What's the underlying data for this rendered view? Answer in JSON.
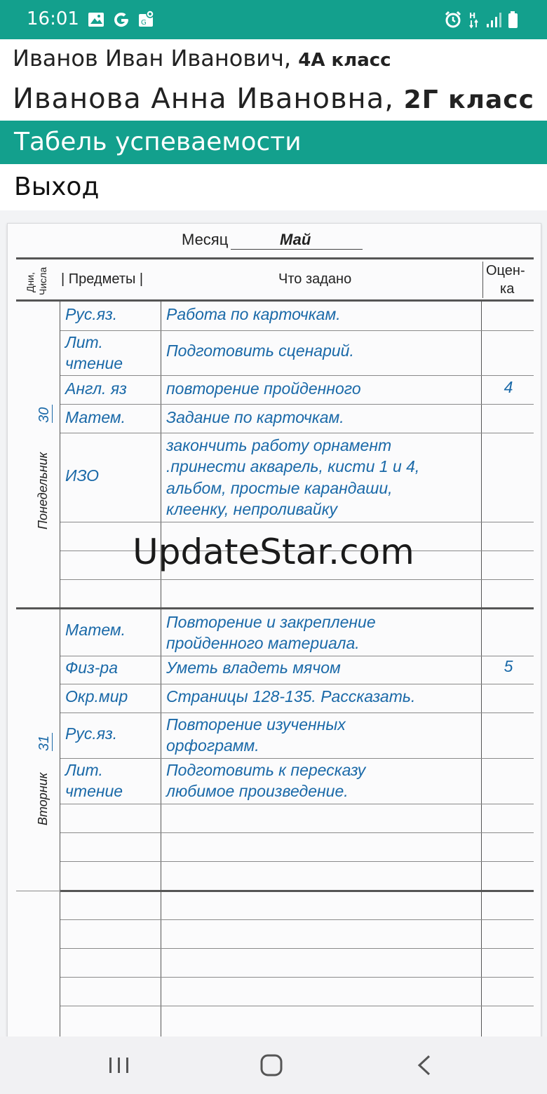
{
  "status_bar": {
    "time": "16:01",
    "left_icons": [
      "image-icon",
      "google-icon",
      "maps-icon"
    ],
    "right_icons": [
      "alarm-icon",
      "network-h-icon",
      "signal-icon",
      "battery-icon"
    ],
    "color": "#13a08d"
  },
  "menu": {
    "students": [
      {
        "name": "Иванов Иван Иванович,",
        "class": "4А класс"
      },
      {
        "name": "Иванова Анна Ивановна,",
        "class": "2Г класс"
      }
    ],
    "tabel_label": "Табель успеваемости",
    "exit_label": "Выход"
  },
  "diary": {
    "month_label": "Месяц",
    "month_value": "Май",
    "headers": {
      "days_line1": "Дни,",
      "days_line2": "Числа",
      "subjects": "| Предметы  |",
      "task": "Что задано",
      "grade_line1": "Оцен-",
      "grade_line2": "ка"
    },
    "days": [
      {
        "day_name": "Понедельник",
        "day_number": "30",
        "rows": [
          {
            "subject": [
              "Рус.яз."
            ],
            "task": [
              "Работа по карточкам."
            ],
            "grade": ""
          },
          {
            "subject": [
              "Лит.",
              "чтение"
            ],
            "task": [
              "Подготовить сценарий."
            ],
            "grade": ""
          },
          {
            "subject": [
              "Англ. яз"
            ],
            "task": [
              "повторение пройденного"
            ],
            "grade": "4"
          },
          {
            "subject": [
              "Матем."
            ],
            "task": [
              "Задание по карточкам."
            ],
            "grade": ""
          },
          {
            "subject": [
              "ИЗО"
            ],
            "task": [
              "закончить работу орнамент",
              ".принести акварель, кисти 1 и 4,",
              "альбом, простые карандаши,",
              "клеенку, непроливайку"
            ],
            "grade": ""
          }
        ]
      },
      {
        "day_name": "Вторник",
        "day_number": "31",
        "rows": [
          {
            "subject": [
              "Матем."
            ],
            "task": [
              "Повторение и закрепление",
              "пройденного материала."
            ],
            "grade": ""
          },
          {
            "subject": [
              "Физ-ра"
            ],
            "task": [
              "Уметь владеть мячом"
            ],
            "grade": "5"
          },
          {
            "subject": [
              "Окр.мир"
            ],
            "task": [
              "Страницы 128-135. Рассказать."
            ],
            "grade": ""
          },
          {
            "subject": [
              "Рус.яз."
            ],
            "task": [
              "Повторение изученных",
              "орфограмм."
            ],
            "grade": ""
          },
          {
            "subject": [
              "Лит.",
              "чтение"
            ],
            "task": [
              "Подготовить к пересказу",
              "любимое произведение."
            ],
            "grade": ""
          }
        ]
      }
    ]
  },
  "watermark": "UpdateStar.com",
  "nav": {
    "buttons": [
      "recents-icon",
      "home-icon",
      "back-icon"
    ]
  }
}
